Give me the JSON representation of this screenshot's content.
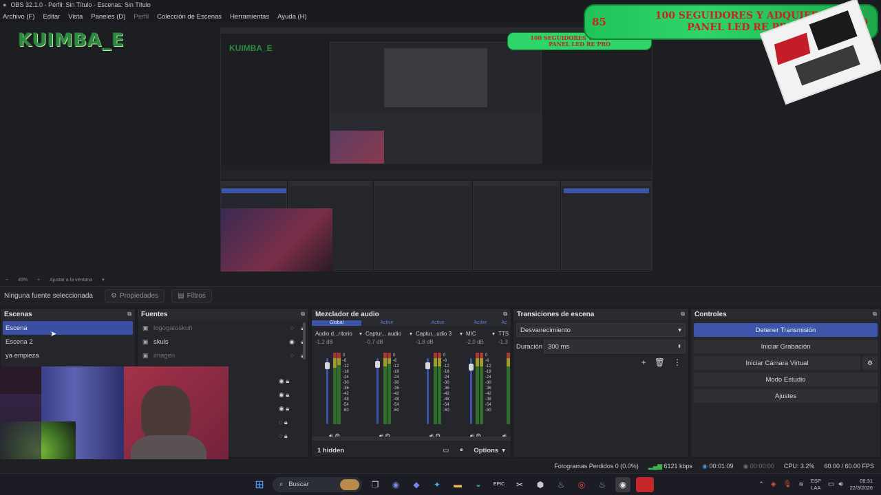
{
  "window": {
    "title": "OBS 32.1.0 - Perfil: Sin Título - Escenas: Sin Título"
  },
  "menu": {
    "items": [
      "Archivo (F)",
      "Editar",
      "Vista",
      "Paneles (D)",
      "Perfil",
      "Colección de Escenas",
      "Herramientas",
      "Ayuda (H)"
    ]
  },
  "preview": {
    "overlay_name": "KUIMBA_E",
    "banner_number": "85",
    "banner_line1": "100 SEGUIDORES Y ADQUIERO",
    "banner_line2": "PANEL LED RE PRO",
    "banner_number_right": "100"
  },
  "zoom": {
    "level": "49%",
    "fit": "Ajustar a la ventana"
  },
  "source_toolbar": {
    "no_source": "Ninguna fuente seleccionada",
    "properties": "Propiedades",
    "filters": "Filtros"
  },
  "scenes": {
    "title": "Escenas",
    "items": [
      "Escena",
      "Escena 2",
      "ya empieza"
    ]
  },
  "sources": {
    "title": "Fuentes",
    "items": [
      "logogatoskuñ",
      "skuls",
      "imagen"
    ]
  },
  "mixer": {
    "title": "Mezclador de audio",
    "tabs": [
      "Global",
      "Active",
      "Active",
      "Active",
      "Ac"
    ],
    "channels": [
      {
        "name": "Audio d...ritorio",
        "db": "-1.2 dB"
      },
      {
        "name": "Captur... audio",
        "db": "-0.7 dB"
      },
      {
        "name": "Captur...udio 3",
        "db": "-1.8 dB"
      },
      {
        "name": "MIC",
        "db": "-2.0 dB"
      },
      {
        "name": "TTS",
        "db": "-1.3"
      }
    ],
    "scale": [
      "0",
      "-6",
      "-12",
      "-18",
      "-24",
      "-30",
      "-36",
      "-42",
      "-48",
      "-54",
      "-60"
    ],
    "hidden": "1 hidden",
    "options": "Options"
  },
  "transitions": {
    "title": "Transiciones de escena",
    "selected": "Desvanecimiento",
    "duration_label": "Duración",
    "duration_value": "300 ms"
  },
  "controls": {
    "title": "Controles",
    "buttons": [
      "Detener Transmisión",
      "Iniciar Grabación",
      "Iniciar Cámara Virtual",
      "Modo Estudio",
      "Ajustes"
    ]
  },
  "status": {
    "dropped": "Fotogramas Perdidos 0 (0.0%)",
    "bitrate": "6121 kbps",
    "stream_time": "00:01:09",
    "rec_time": "00:00:00",
    "cpu": "CPU: 3.2%",
    "fps": "60.00 / 60.00 FPS"
  },
  "taskbar": {
    "search": "Buscar",
    "lang": "ESP",
    "lang2": "LAA",
    "time": "09:31",
    "date": "22/3/2026"
  },
  "colors": {
    "accent": "#3d55a9",
    "panel": "#25262b",
    "banner_green": "#2fd56a",
    "banner_text": "#c4261b"
  }
}
